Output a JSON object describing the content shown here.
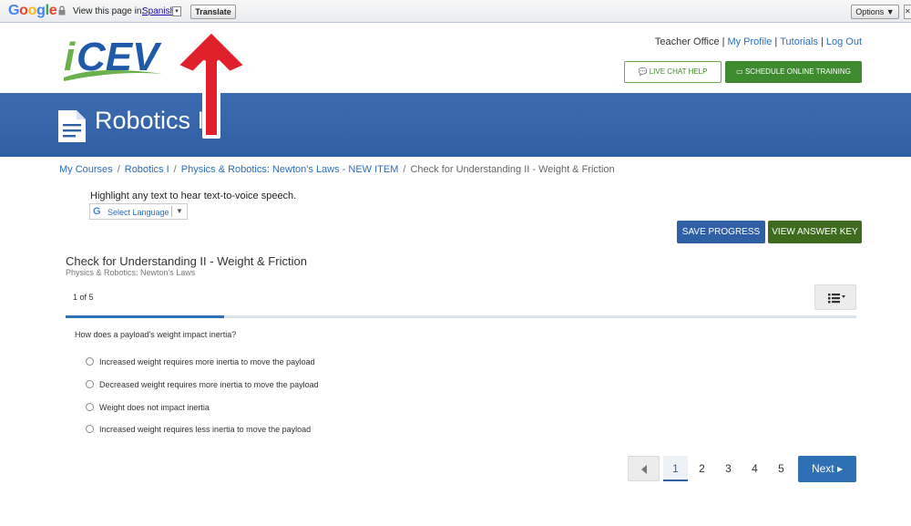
{
  "translate_bar": {
    "brand": "Google",
    "label": "View this page in:",
    "language": "Spanish",
    "translate_button": "Translate",
    "options_button": "Options ▼"
  },
  "header": {
    "logo_text": "iCEV",
    "links": [
      "Teacher Office",
      "My Profile",
      "Tutorials",
      "Log Out"
    ],
    "live_chat": "LIVE CHAT HELP",
    "schedule_training": "SCHEDULE ONLINE TRAINING"
  },
  "banner": {
    "title": "Robotics I"
  },
  "breadcrumb": {
    "items": [
      "My Courses",
      "Robotics I",
      "Physics & Robotics: Newton's Laws - NEW ITEM"
    ],
    "current": "Check for Understanding II - Weight & Friction"
  },
  "tts": {
    "instruction": "Highlight any text to hear text-to-voice speech.",
    "select_language": "Select Language"
  },
  "actions": {
    "save_progress": "SAVE PROGRESS",
    "view_answer_key": "VIEW ANSWER KEY"
  },
  "quiz": {
    "title": "Check for Understanding II - Weight & Friction",
    "subtitle": "Physics & Robotics: Newton's Laws",
    "counter": "1 of 5",
    "progress_fraction": 0.2,
    "question": "How does a payload's weight impact inertia?",
    "options": [
      "Increased weight requires more inertia to move the payload",
      "Decreased weight requires more inertia to move the payload",
      "Weight does not impact inertia",
      "Increased weight requires less inertia to move the payload"
    ]
  },
  "pagination": {
    "pages": [
      "1",
      "2",
      "3",
      "4",
      "5"
    ],
    "current": "1",
    "next_label": "Next"
  },
  "colors": {
    "primary_blue": "#2f5fa5",
    "accent_green": "#3d8b2e",
    "dark_green": "#3e6b1e",
    "arrow_red": "#e0202a"
  }
}
